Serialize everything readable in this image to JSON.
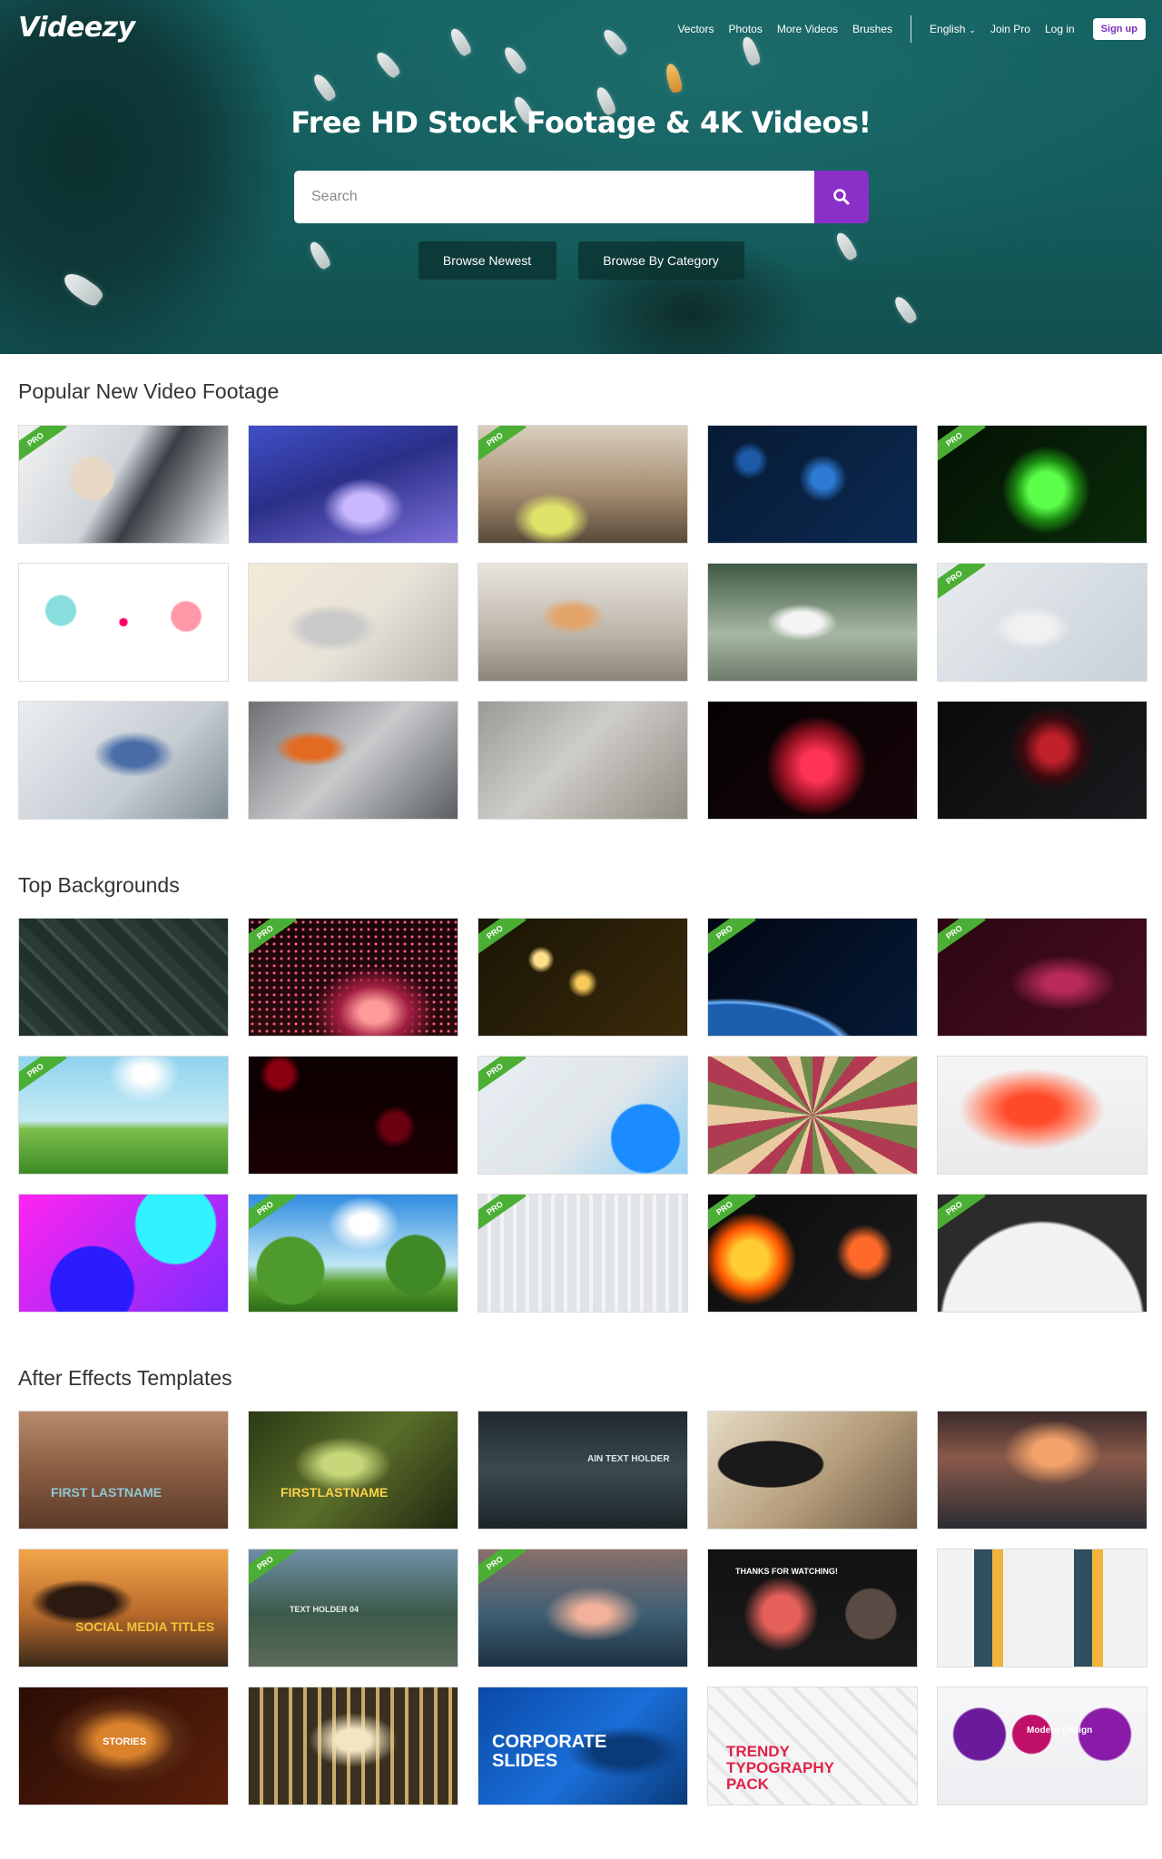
{
  "brand": {
    "logo": "Videezy"
  },
  "nav": {
    "links": [
      "Vectors",
      "Photos",
      "More Videos",
      "Brushes"
    ],
    "language": "English",
    "join_pro": "Join Pro",
    "login": "Log in",
    "signup": "Sign up"
  },
  "hero": {
    "title": "Free HD Stock Footage & 4K Videos!",
    "search_placeholder": "Search",
    "browse_newest": "Browse Newest",
    "browse_category": "Browse By Category"
  },
  "colors": {
    "accent": "#8b2fc9",
    "pro_badge": "#4caf35",
    "signup_text": "#7b2fbf"
  },
  "sections": [
    {
      "title": "Popular New Video Footage",
      "pro_flags": [
        true,
        false,
        true,
        false,
        true,
        false,
        false,
        false,
        false,
        true,
        false,
        false,
        false,
        false,
        false
      ],
      "captions": [
        "",
        "",
        "",
        "",
        "",
        "",
        "",
        "",
        "",
        "",
        "",
        "",
        "",
        "",
        ""
      ]
    },
    {
      "title": "Top Backgrounds",
      "pro_flags": [
        false,
        true,
        true,
        true,
        true,
        true,
        false,
        true,
        false,
        false,
        false,
        true,
        true,
        true,
        true
      ],
      "captions": [
        "",
        "",
        "",
        "",
        "",
        "",
        "",
        "",
        "",
        "",
        "",
        "",
        "",
        "",
        ""
      ]
    },
    {
      "title": "After Effects Templates",
      "pro_flags": [
        false,
        false,
        false,
        false,
        false,
        false,
        true,
        true,
        false,
        false,
        false,
        false,
        false,
        false,
        false
      ],
      "captions": [
        "FIRST LASTNAME",
        "FIRSTLASTNAME",
        "AIN TEXT HOLDER",
        "",
        "",
        "SOCIAL MEDIA TITLES",
        "TEXT HOLDER 04",
        "",
        "THANKS FOR WATCHING!",
        "",
        "STORIES",
        "",
        "CORPORATE SLIDES",
        "TRENDY TYPOGRAPHY PACK",
        "Modern Design"
      ]
    }
  ],
  "badge_label": "PRO",
  "watermark": "Videezy"
}
